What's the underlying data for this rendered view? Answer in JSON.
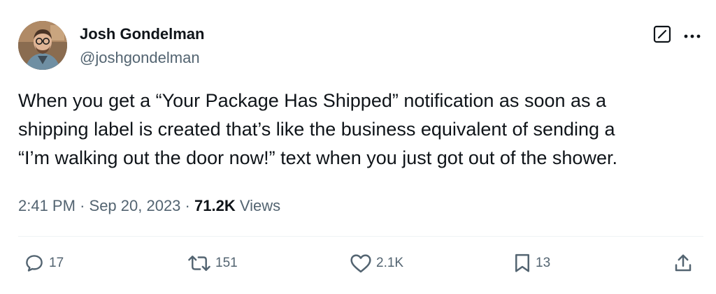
{
  "author": {
    "name": "Josh Gondelman",
    "handle": "@joshgondelman"
  },
  "tweet": {
    "lines": [
      "When you get a “Your Package Has Shipped” notification as soon as a",
      "shipping label is created that’s like the business equivalent of sending a",
      "“I’m walking out the door now!” text when you just got out of the shower."
    ]
  },
  "meta": {
    "time": "2:41 PM",
    "separator": "·",
    "date": "Sep 20, 2023",
    "views_count": "71.2K",
    "views_label": "Views"
  },
  "actions": {
    "replies": "17",
    "reposts": "151",
    "likes": "2.1K",
    "bookmarks": "13"
  },
  "icons": {
    "edit": "edit-square-icon",
    "more": "more-dots-icon",
    "reply": "reply-bubble-icon",
    "repost": "repost-arrows-icon",
    "like": "heart-icon",
    "bookmark": "bookmark-icon",
    "share": "share-upload-icon"
  },
  "colors": {
    "text": "#0f1419",
    "secondary": "#536471",
    "divider": "#eff3f4"
  }
}
